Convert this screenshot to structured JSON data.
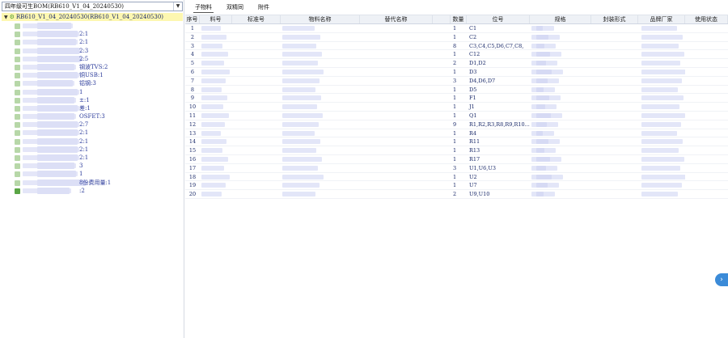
{
  "left_panel": {
    "combo_value": "四年级可生BOM(RB610_V1_04_20240530)",
    "root_label": "RB610_V1_04_20240530(RB610_V1_04_20240530)",
    "tree_items": [
      {
        "label": "",
        "icon_color": "#b7d7a8"
      },
      {
        "label": "2:1",
        "icon_color": "#b7d7a8"
      },
      {
        "label": "2:1",
        "icon_color": "#b7d7a8"
      },
      {
        "label": "2:3",
        "icon_color": "#b7d7a8"
      },
      {
        "label": "2:5",
        "icon_color": "#b7d7a8"
      },
      {
        "label": "钢波TVS:2",
        "icon_color": "#b7d7a8"
      },
      {
        "label": "铜USB:1",
        "icon_color": "#b7d7a8"
      },
      {
        "label": "铝钢:3",
        "icon_color": "#b7d7a8"
      },
      {
        "label": "1",
        "icon_color": "#b7d7a8"
      },
      {
        "label": "±:1",
        "icon_color": "#b7d7a8"
      },
      {
        "label": "差:1",
        "icon_color": "#b7d7a8"
      },
      {
        "label": "OSFET:3",
        "icon_color": "#b7d7a8"
      },
      {
        "label": "2:7",
        "icon_color": "#b7d7a8"
      },
      {
        "label": "2:1",
        "icon_color": "#b7d7a8"
      },
      {
        "label": "2:1",
        "icon_color": "#b7d7a8"
      },
      {
        "label": "2:1",
        "icon_color": "#b7d7a8"
      },
      {
        "label": "2:1",
        "icon_color": "#b7d7a8"
      },
      {
        "label": "3",
        "icon_color": "#b7d7a8"
      },
      {
        "label": "1",
        "icon_color": "#b7d7a8"
      },
      {
        "label": "8份费用量:1",
        "icon_color": "#b7d7a8"
      },
      {
        "label": ":2",
        "icon_color": "#5aa545"
      }
    ]
  },
  "tabs": [
    {
      "label": "子物料",
      "active": true
    },
    {
      "label": "双精同",
      "active": false
    },
    {
      "label": "附件",
      "active": false
    }
  ],
  "columns": [
    "序号",
    "料号",
    "标准号",
    "物料名称",
    "替代名称",
    "",
    "数量",
    "位号",
    "规格",
    "封装形式",
    "品牌厂家",
    "使用状态"
  ],
  "rows": [
    {
      "no": "1",
      "qty": "1",
      "pos": "C1"
    },
    {
      "no": "2",
      "qty": "1",
      "pos": "C2"
    },
    {
      "no": "3",
      "qty": "8",
      "pos": "C3,C4,C5,D6,C7,C8,"
    },
    {
      "no": "4",
      "qty": "1",
      "pos": "C12"
    },
    {
      "no": "5",
      "qty": "2",
      "pos": "D1,D2"
    },
    {
      "no": "6",
      "qty": "1",
      "pos": "D3"
    },
    {
      "no": "7",
      "qty": "3",
      "pos": "D4,D6,D7"
    },
    {
      "no": "8",
      "qty": "1",
      "pos": "D5"
    },
    {
      "no": "9",
      "qty": "1",
      "pos": "F1"
    },
    {
      "no": "10",
      "qty": "1",
      "pos": "J1"
    },
    {
      "no": "11",
      "qty": "1",
      "pos": "Q1"
    },
    {
      "no": "12",
      "qty": "9",
      "pos": "R1,R2,R3,R8,R9,R10..."
    },
    {
      "no": "13",
      "qty": "1",
      "pos": "R4"
    },
    {
      "no": "14",
      "qty": "1",
      "pos": "R11"
    },
    {
      "no": "15",
      "qty": "1",
      "pos": "R13"
    },
    {
      "no": "16",
      "qty": "1",
      "pos": "R17"
    },
    {
      "no": "17",
      "qty": "3",
      "pos": "U1,U6,U3"
    },
    {
      "no": "18",
      "qty": "1",
      "pos": "U2"
    },
    {
      "no": "19",
      "qty": "1",
      "pos": "U7"
    },
    {
      "no": "20",
      "qty": "2",
      "pos": "U9,U10"
    }
  ],
  "expand_button": "›"
}
